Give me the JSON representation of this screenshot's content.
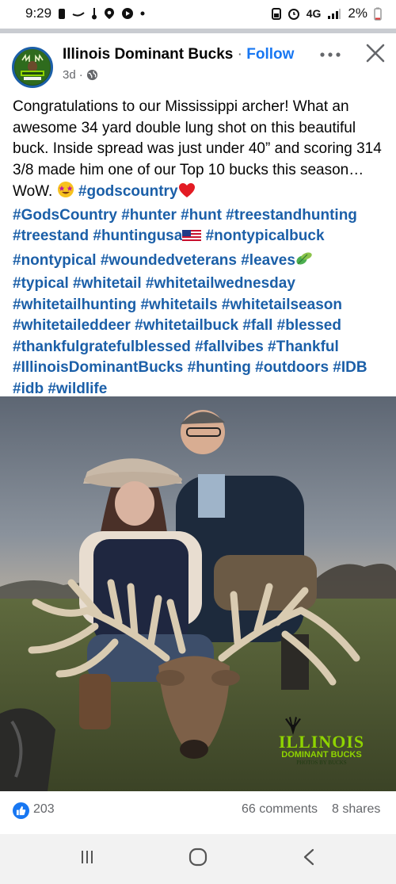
{
  "status_bar": {
    "time": "9:29",
    "network": "4G",
    "battery": "2%"
  },
  "post": {
    "page_name": "Illinois Dominant Bucks",
    "separator": " · ",
    "follow_label": "Follow",
    "age": "3d",
    "meta_separator": "·",
    "caption_text": "Congratulations to our Mississippi archer! What an awesome 34 yard double lung shot on this beautiful buck.  Inside spread was just under 40” and scoring 314 3/8 made him one of our Top 10 bucks this season… WoW. ",
    "hashtag_lines": [
      "#godscountry",
      "#GodsCountry #hunter #hunt #treestandhunting",
      "#treestand #huntingusa",
      " #nontypicalbuck",
      "#nontypical #woundedveterans #leaves",
      "#typical #whitetail #whitetailwednesday",
      "#whitetailhunting #whitetails #whitetailseason",
      "#whitetaileddeer #whitetailbuck #fall #blessed",
      "#thankfulgratefulblessed #fallvibes #Thankful",
      "#IllinoisDominantBucks #hunting #outdoors #IDB",
      "#idb #wildlife"
    ],
    "watermark": {
      "line1": "ILLINOIS",
      "line2": "DOMINANT BUCKS",
      "line3": "PHOTOS BY BUCKS"
    },
    "likes": "203",
    "comments": "66 comments",
    "shares": "8 shares"
  },
  "icons": {
    "more": "more-dots-icon",
    "close": "close-icon",
    "globe": "globe-icon",
    "like": "thumbs-up-icon",
    "nav_recents": "recent-apps-icon",
    "nav_home": "home-icon",
    "nav_back": "back-icon"
  },
  "colors": {
    "link_blue": "#1b5fa8",
    "follow_blue": "#1877f2",
    "meta_gray": "#65676b",
    "watermark_green": "#8fd400"
  }
}
